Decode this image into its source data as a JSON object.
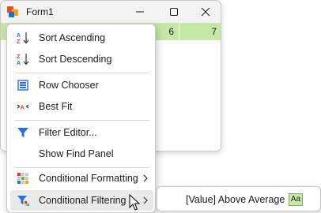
{
  "window": {
    "title": "Form1",
    "icons": {
      "app": "windows-forms-app-icon",
      "minimize": "minimize-icon",
      "maximize": "maximize-icon",
      "close": "close-icon"
    }
  },
  "grid": {
    "row_color": "#c6e8a6",
    "visible_cells": [
      "6",
      "7"
    ]
  },
  "context_menu": {
    "items": [
      {
        "label": "Sort Ascending",
        "icon": "sort-ascending-icon"
      },
      {
        "label": "Sort Descending",
        "icon": "sort-descending-icon"
      },
      {
        "label": "Row Chooser",
        "icon": "row-chooser-icon"
      },
      {
        "label": "Best Fit",
        "icon": "best-fit-icon"
      },
      {
        "label": "Filter Editor...",
        "icon": "filter-icon"
      },
      {
        "label": "Show Find Panel",
        "icon": ""
      },
      {
        "label": "Conditional Formatting",
        "icon": "conditional-formatting-icon"
      },
      {
        "label": "Conditional Filtering",
        "icon": "conditional-filtering-icon"
      }
    ]
  },
  "submenu": {
    "items": [
      {
        "label": "[Value] Above Average",
        "sample": "Aa",
        "sample_color": "#c6e8a6"
      }
    ]
  }
}
